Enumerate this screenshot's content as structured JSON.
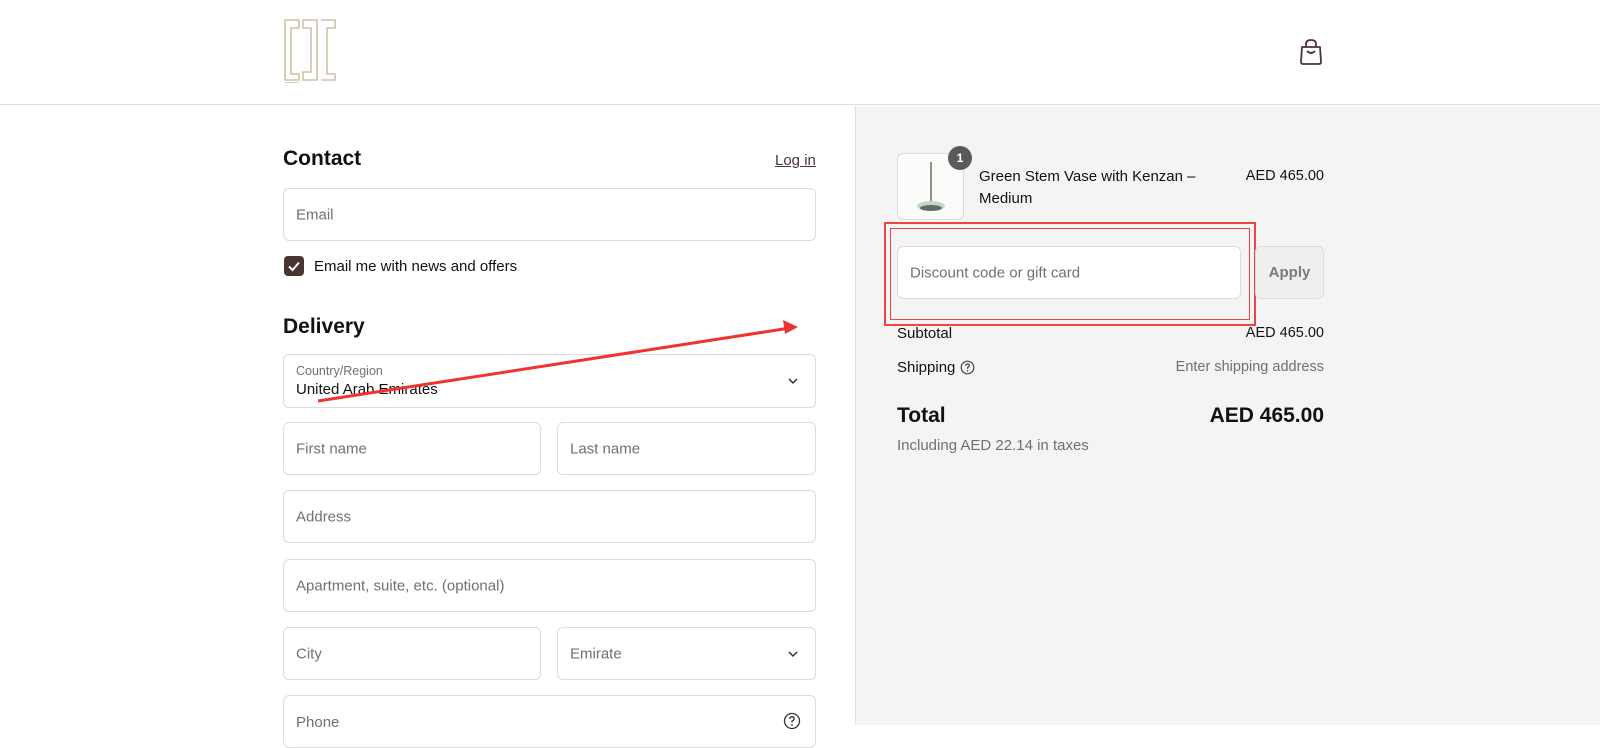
{
  "header": {
    "logo_icon": "sos-monogram-logo",
    "cart_icon": "shopping-bag-icon"
  },
  "contact": {
    "title": "Contact",
    "login_label": "Log in",
    "email_placeholder": "Email",
    "newsletter_label": "Email me with news and offers",
    "newsletter_checked": true
  },
  "delivery": {
    "title": "Delivery",
    "country_label": "Country/Region",
    "country_value": "United Arab Emirates",
    "first_name_placeholder": "First name",
    "last_name_placeholder": "Last name",
    "address_placeholder": "Address",
    "apartment_placeholder": "Apartment, suite, etc. (optional)",
    "city_placeholder": "City",
    "emirate_placeholder": "Emirate",
    "phone_placeholder": "Phone"
  },
  "summary": {
    "product": {
      "name": "Green Stem Vase with Kenzan – Medium",
      "price": "AED 465.00",
      "quantity": "1"
    },
    "discount_placeholder": "Discount code or gift card",
    "apply_label": "Apply",
    "subtotal_label": "Subtotal",
    "subtotal_value": "AED 465.00",
    "shipping_label": "Shipping",
    "shipping_value": "Enter shipping address",
    "total_label": "Total",
    "total_value": "AED 465.00",
    "tax_note": "Including AED 22.14 in taxes"
  },
  "annotation_color": "#ee3333",
  "accent_color": "#4a3431"
}
